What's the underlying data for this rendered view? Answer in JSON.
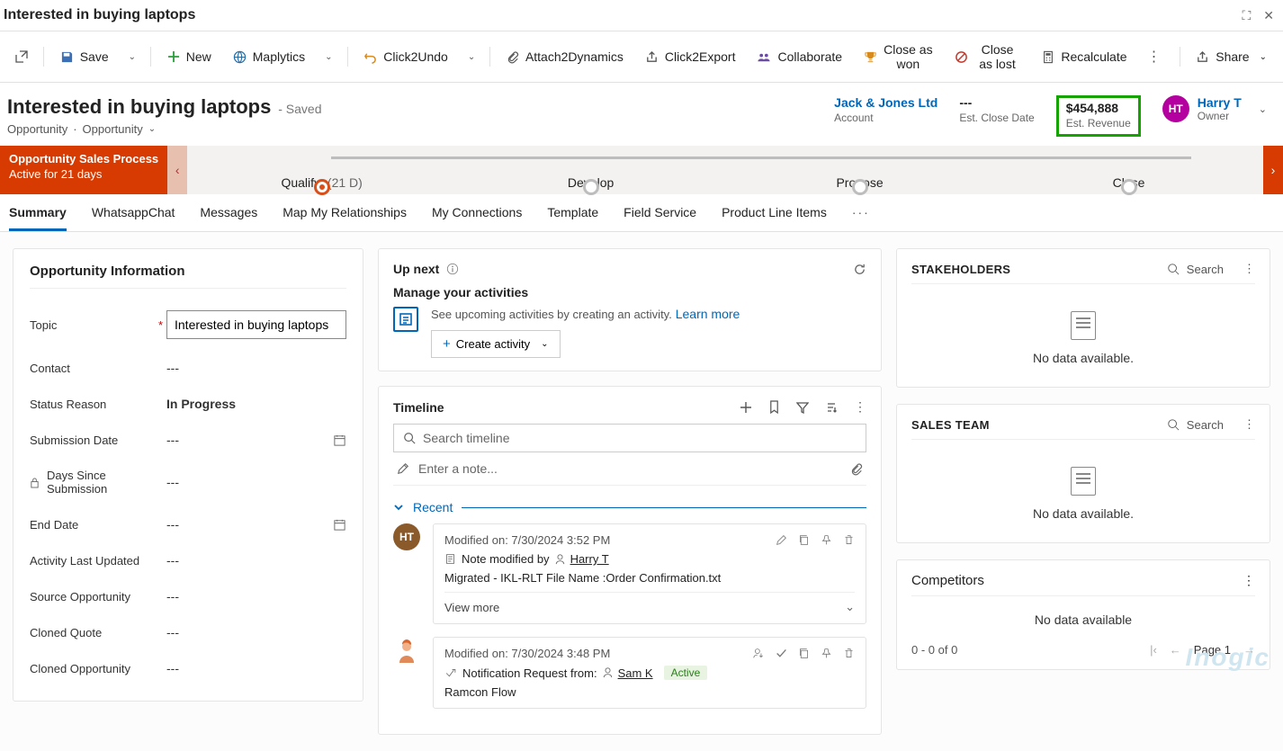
{
  "window": {
    "title": "Interested in buying laptops"
  },
  "toolbar": {
    "save": "Save",
    "new": "New",
    "maplytics": "Maplytics",
    "click2undo": "Click2Undo",
    "attach": "Attach2Dynamics",
    "click2export": "Click2Export",
    "collaborate": "Collaborate",
    "close_won": "Close as won",
    "close_lost": "Close as lost",
    "recalc": "Recalculate",
    "share": "Share"
  },
  "header": {
    "title": "Interested in buying laptops",
    "saved_suffix": "- Saved",
    "entity": "Opportunity",
    "form": "Opportunity",
    "account_name": "Jack & Jones Ltd",
    "account_label": "Account",
    "close_date_val": "---",
    "close_date_label": "Est. Close Date",
    "revenue_val": "$454,888",
    "revenue_label": "Est. Revenue",
    "owner_initials": "HT",
    "owner_name": "Harry T",
    "owner_label": "Owner"
  },
  "process": {
    "name": "Opportunity Sales Process",
    "active_for": "Active for 21 days",
    "stages": [
      {
        "label": "Qualify",
        "days": "(21 D)",
        "active": true
      },
      {
        "label": "Develop"
      },
      {
        "label": "Propose"
      },
      {
        "label": "Close"
      }
    ]
  },
  "tabs": [
    "Summary",
    "WhatsappChat",
    "Messages",
    "Map My Relationships",
    "My Connections",
    "Template",
    "Field Service",
    "Product Line Items"
  ],
  "opportunity_info": {
    "section_title": "Opportunity Information",
    "fields": {
      "topic_label": "Topic",
      "topic_value": "Interested in buying laptops",
      "contact_label": "Contact",
      "contact_value": "---",
      "status_label": "Status Reason",
      "status_value": "In Progress",
      "submission_label": "Submission Date",
      "submission_value": "---",
      "days_since_label": "Days Since Submission",
      "days_since_value": "---",
      "end_date_label": "End Date",
      "end_date_value": "---",
      "activity_label": "Activity Last Updated",
      "activity_value": "---",
      "source_label": "Source Opportunity",
      "source_value": "---",
      "cloned_quote_label": "Cloned Quote",
      "cloned_quote_value": "---",
      "cloned_opp_label": "Cloned Opportunity",
      "cloned_opp_value": "---"
    }
  },
  "upnext": {
    "title": "Up next",
    "heading": "Manage your activities",
    "text": "See upcoming activities by creating an activity.",
    "learn_more": "Learn more",
    "create": "Create activity"
  },
  "timeline": {
    "title": "Timeline",
    "search_placeholder": "Search timeline",
    "note_placeholder": "Enter a note...",
    "recent_label": "Recent",
    "items": [
      {
        "avatar": "HT",
        "modified": "Modified on: 7/30/2024 3:52 PM",
        "prefix": "Note modified by",
        "user": "Harry T",
        "body": "Migrated - IKL-RLT File Name :Order Confirmation.txt",
        "view_more": "View more"
      },
      {
        "avatar_type": "person",
        "modified": "Modified on: 7/30/2024 3:48 PM",
        "prefix": "Notification Request from:",
        "user": "Sam K",
        "badge": "Active",
        "body": "Ramcon Flow"
      }
    ]
  },
  "stakeholders": {
    "title": "STAKEHOLDERS",
    "search": "Search",
    "empty": "No data available."
  },
  "salesteam": {
    "title": "SALES TEAM",
    "search": "Search",
    "empty": "No data available."
  },
  "competitors": {
    "title": "Competitors",
    "empty": "No data available",
    "range": "0 - 0 of 0",
    "page": "Page 1"
  },
  "watermark": "Inogic"
}
